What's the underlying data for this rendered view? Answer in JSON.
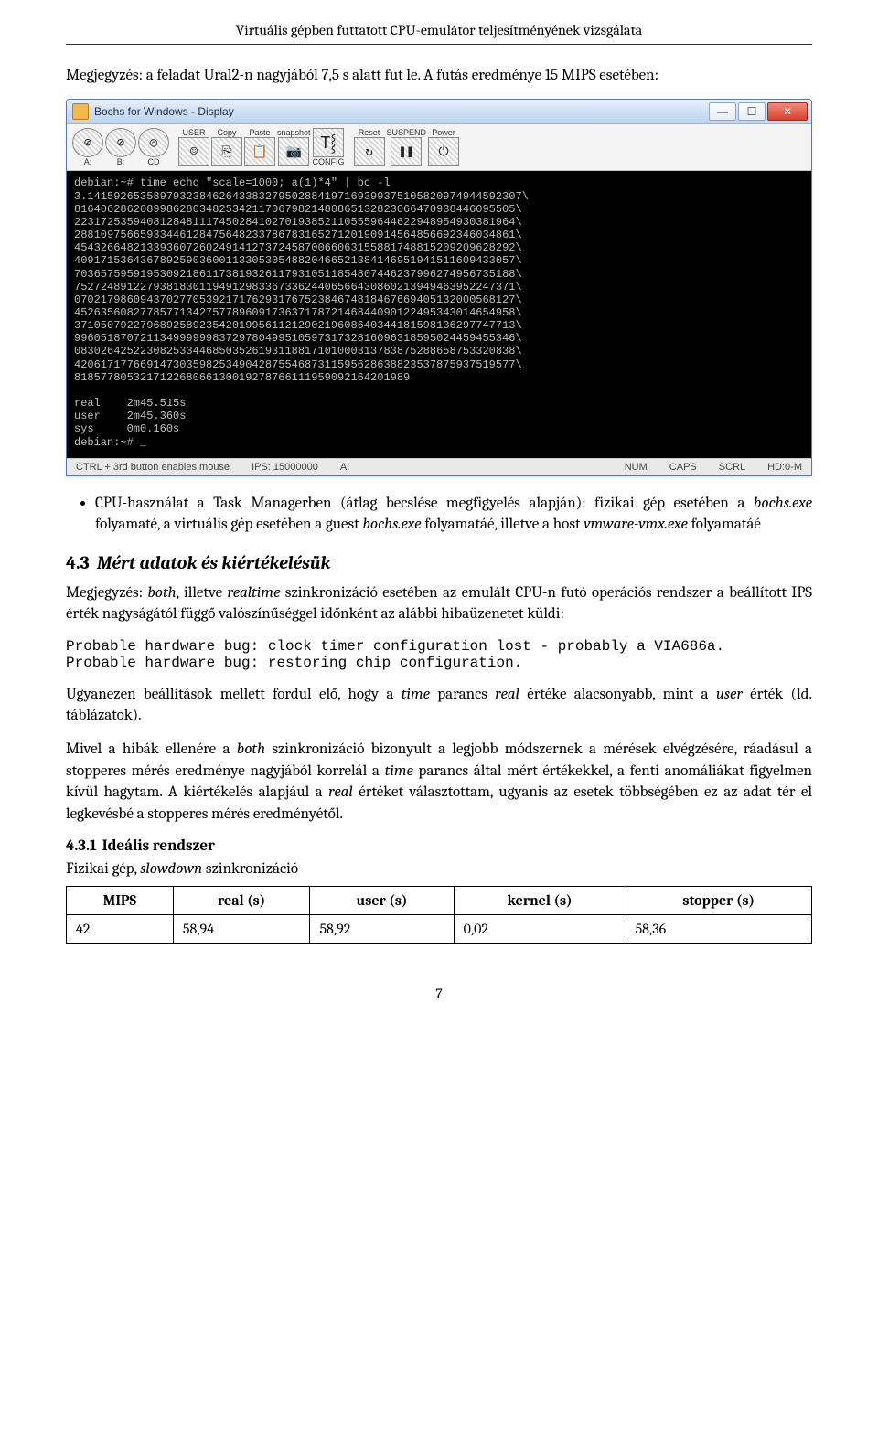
{
  "header": {
    "title": "Virtuális gépben futtatott CPU-emulátor teljesítményének vizsgálata"
  },
  "intro": {
    "line1_a": "Megjegyzés: a feladat Ural2-n nagyjából 7,5 s alatt fut le.",
    "line1_b": "A futás eredménye 15 MIPS esetében:"
  },
  "window": {
    "title": "Bochs for Windows - Display",
    "toolbar": {
      "driveA": "A:",
      "driveB": "B:",
      "cd": "CD",
      "user": "USER",
      "copy": "Copy",
      "paste": "Paste",
      "snapshot": "snapshot",
      "config": "CONFIG",
      "reset": "Reset",
      "suspend": "SUSPEND",
      "power": "Power"
    },
    "terminal_lines": [
      "debian:~# time echo \"scale=1000; a(1)*4\" | bc -l",
      "3.141592653589793238462643383279502884197169399375105820974944592307\\",
      "8164062862089986280348253421170679821480865132823066470938446095505\\",
      "2231725359408128481117450284102701938521105559644622948954930381964\\",
      "2881097566593344612847564823378678316527120190914564856692346034861\\",
      "4543266482133936072602491412737245870066063155881748815209209628292\\",
      "4091715364367892590360011330530548820466521384146951941511609433057\\",
      "7036575959195309218611738193261179310511854807446237996274956735188\\",
      "7527248912279381830119491298336733624406566430860213949463952247371\\",
      "0702179860943702770539217176293176752384674818467669405132000568127\\",
      "4526356082778577134275778960917363717872146844090122495343014654958\\",
      "3710507922796892589235420199561121290219608640344181598136297747713\\",
      "9960518707211349999998372978049951059731732816096318595024459455346\\",
      "0830264252230825334468503526193118817101000313783875288658753320838\\",
      "4206171776691473035982534904287554687311595628638823537875937519577\\",
      "818577805321712268066130019278766111959092164201989",
      "",
      "real    2m45.515s",
      "user    2m45.360s",
      "sys     0m0.160s",
      "debian:~# _"
    ],
    "status": {
      "mouse": "CTRL + 3rd button enables mouse",
      "ips": "IPS: 15000000",
      "a": "A:",
      "num": "NUM",
      "caps": "CAPS",
      "scrl": "SCRL",
      "hd": "HD:0-M"
    }
  },
  "bullet": {
    "text_a": "CPU-használat a Task Managerben (átlag becslése megfigyelés alapján): fizikai gép esetében a ",
    "i1": "bochs.exe",
    "text_b": " folyamaté, a virtuális gép esetében a guest ",
    "i2": "bochs.exe",
    "text_c": " folyamatáé, illetve a host ",
    "i3": "vmware-vmx.exe",
    "text_d": " folyamatáé"
  },
  "sec43": {
    "num": "4.3",
    "title": "Mért adatok és kiértékelésük",
    "p1_a": "Megjegyzés: ",
    "p1_i1": "both",
    "p1_b": ", illetve ",
    "p1_i2": "realtime",
    "p1_c": " szinkronizáció esetében az emulált CPU-n futó operációs rendszer a beállított IPS érték nagyságától függő valószínűséggel időnként az alábbi hibaüzenetet küldi:",
    "code1": "Probable hardware bug: clock timer configuration lost - probably a VIA686a.",
    "code2": "Probable hardware bug: restoring chip configuration.",
    "p2_a": "Ugyanezen beállítások mellett fordul elő, hogy a ",
    "p2_i1": "time",
    "p2_b": " parancs ",
    "p2_i2": "real",
    "p2_c": " értéke alacsonyabb, mint a ",
    "p2_i3": "user",
    "p2_d": " érték (ld. táblázatok).",
    "p3_a": "Mivel a hibák ellenére a ",
    "p3_i1": "both",
    "p3_b": " szinkronizáció bizonyult a legjobb módszernek a mérések elvégzésére, ráadásul a stopperes mérés eredménye nagyjából korrelál a ",
    "p3_i2": "time",
    "p3_c": " parancs által mért értékekkel, a fenti anomáliákat figyelmen kívül hagytam. A kiértékelés alapjául a ",
    "p3_i3": "real",
    "p3_d": " értéket választottam, ugyanis az esetek többségében ez az adat tér el legkevésbé a stopperes mérés eredményétől."
  },
  "sec431": {
    "num": "4.3.1",
    "title": "Ideális rendszer",
    "sub_a": "Fizikai gép, ",
    "sub_i": "slowdown",
    "sub_b": " szinkronizáció"
  },
  "table": {
    "headers": [
      "MIPS",
      "real (s)",
      "user (s)",
      "kernel (s)",
      "stopper (s)"
    ],
    "rows": [
      {
        "mips": "42",
        "real": "58,94",
        "user": "58,92",
        "kernel": "0,02",
        "stopper": "58,36"
      }
    ]
  },
  "chart_data": {
    "type": "table",
    "columns": [
      "MIPS",
      "real (s)",
      "user (s)",
      "kernel (s)",
      "stopper (s)"
    ],
    "rows": [
      [
        42,
        58.94,
        58.92,
        0.02,
        58.36
      ]
    ]
  },
  "pagenum": "7"
}
